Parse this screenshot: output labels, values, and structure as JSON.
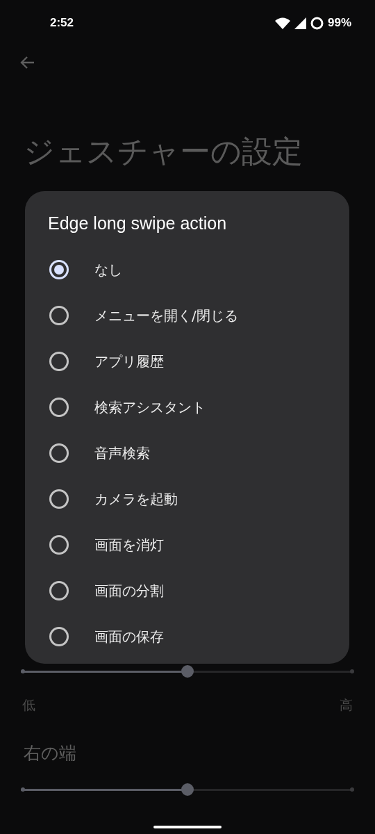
{
  "status_bar": {
    "time": "2:52",
    "battery": "99%"
  },
  "page": {
    "title": "ジェスチャーの設定"
  },
  "sliders": [
    {
      "level": 0.5,
      "low_label": "低",
      "high_label": "高"
    },
    {
      "label": "右の端",
      "level": 0.5
    }
  ],
  "dialog": {
    "title": "Edge long swipe action",
    "options": [
      {
        "label": "なし",
        "selected": true
      },
      {
        "label": "メニューを開く/閉じる",
        "selected": false
      },
      {
        "label": "アプリ履歴",
        "selected": false
      },
      {
        "label": "検索アシスタント",
        "selected": false
      },
      {
        "label": "音声検索",
        "selected": false
      },
      {
        "label": "カメラを起動",
        "selected": false
      },
      {
        "label": "画面を消灯",
        "selected": false
      },
      {
        "label": "画面の分割",
        "selected": false
      },
      {
        "label": "画面の保存",
        "selected": false
      }
    ]
  }
}
